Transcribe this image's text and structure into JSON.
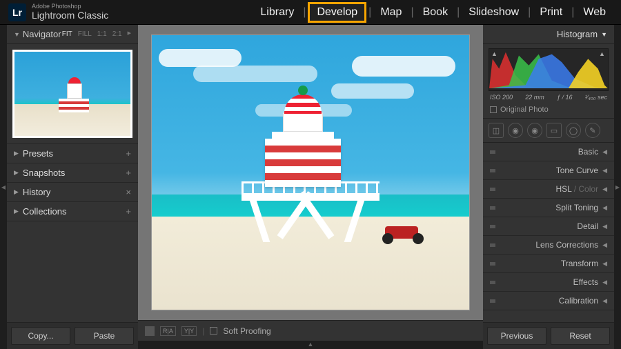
{
  "app": {
    "vendor": "Adobe Photoshop",
    "name": "Lightroom Classic",
    "logo_mark": "Lr"
  },
  "modules": {
    "library": "Library",
    "develop": "Develop",
    "map": "Map",
    "book": "Book",
    "slideshow": "Slideshow",
    "print": "Print",
    "web": "Web",
    "active": "develop"
  },
  "left": {
    "navigator": {
      "title": "Navigator",
      "zoom": {
        "fit": "FIT",
        "fill": "FILL",
        "one": "1:1",
        "two": "2:1"
      }
    },
    "panels": [
      {
        "label": "Presets",
        "end": "+"
      },
      {
        "label": "Snapshots",
        "end": "+"
      },
      {
        "label": "History",
        "end": "×"
      },
      {
        "label": "Collections",
        "end": "+"
      }
    ],
    "footer": {
      "copy": "Copy...",
      "paste": "Paste"
    }
  },
  "toolbar": {
    "before_after_a": "R|A",
    "before_after_b": "Y|Y",
    "soft_proofing": "Soft Proofing"
  },
  "right": {
    "histogram_label": "Histogram",
    "exif": {
      "iso": "ISO 200",
      "focal": "22 mm",
      "aperture": "ƒ / 16",
      "shutter": "¹⁄₄₀₀ sec"
    },
    "original_photo": "Original Photo",
    "adjust": [
      {
        "label": "Basic"
      },
      {
        "label": "Tone Curve"
      },
      {
        "label_pre": "HSL",
        "label_mid": " / ",
        "label_post": "Color"
      },
      {
        "label": "Split Toning"
      },
      {
        "label": "Detail"
      },
      {
        "label": "Lens Corrections"
      },
      {
        "label": "Transform"
      },
      {
        "label": "Effects"
      },
      {
        "label": "Calibration"
      }
    ],
    "footer": {
      "previous": "Previous",
      "reset": "Reset"
    }
  }
}
